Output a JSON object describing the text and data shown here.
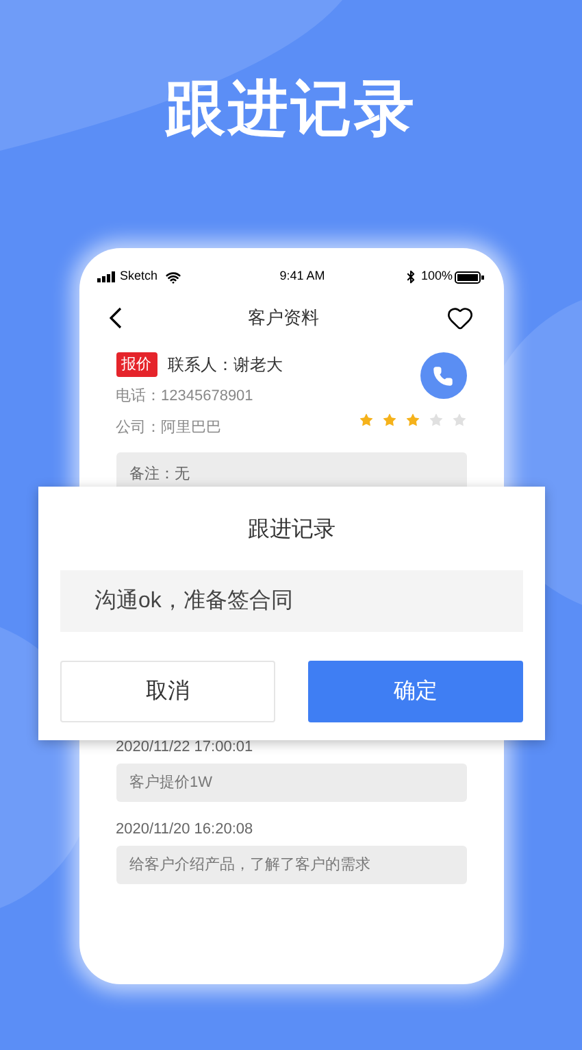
{
  "page_title": "跟进记录",
  "status_bar": {
    "carrier": "Sketch",
    "time": "9:41 AM",
    "battery": "100%"
  },
  "nav": {
    "title": "客户资料",
    "favorited": false
  },
  "customer": {
    "tag": "报价",
    "contact": "联系人：谢老大",
    "phone": "电话：12345678901",
    "company": "公司：阿里巴巴",
    "stars": 3,
    "remark": "备注：无"
  },
  "records": [
    {
      "time": "2020/11/22 17:00:01",
      "note": "客户提价1W"
    },
    {
      "time": "2020/11/20 16:20:08",
      "note": "给客户介绍产品，了解了客户的需求"
    }
  ],
  "dialog": {
    "title": "跟进记录",
    "value": "沟通ok，准备签合同",
    "buttons": [
      {
        "label": "取消",
        "kind": "secondary"
      },
      {
        "label": "确定",
        "kind": "primary"
      }
    ]
  }
}
